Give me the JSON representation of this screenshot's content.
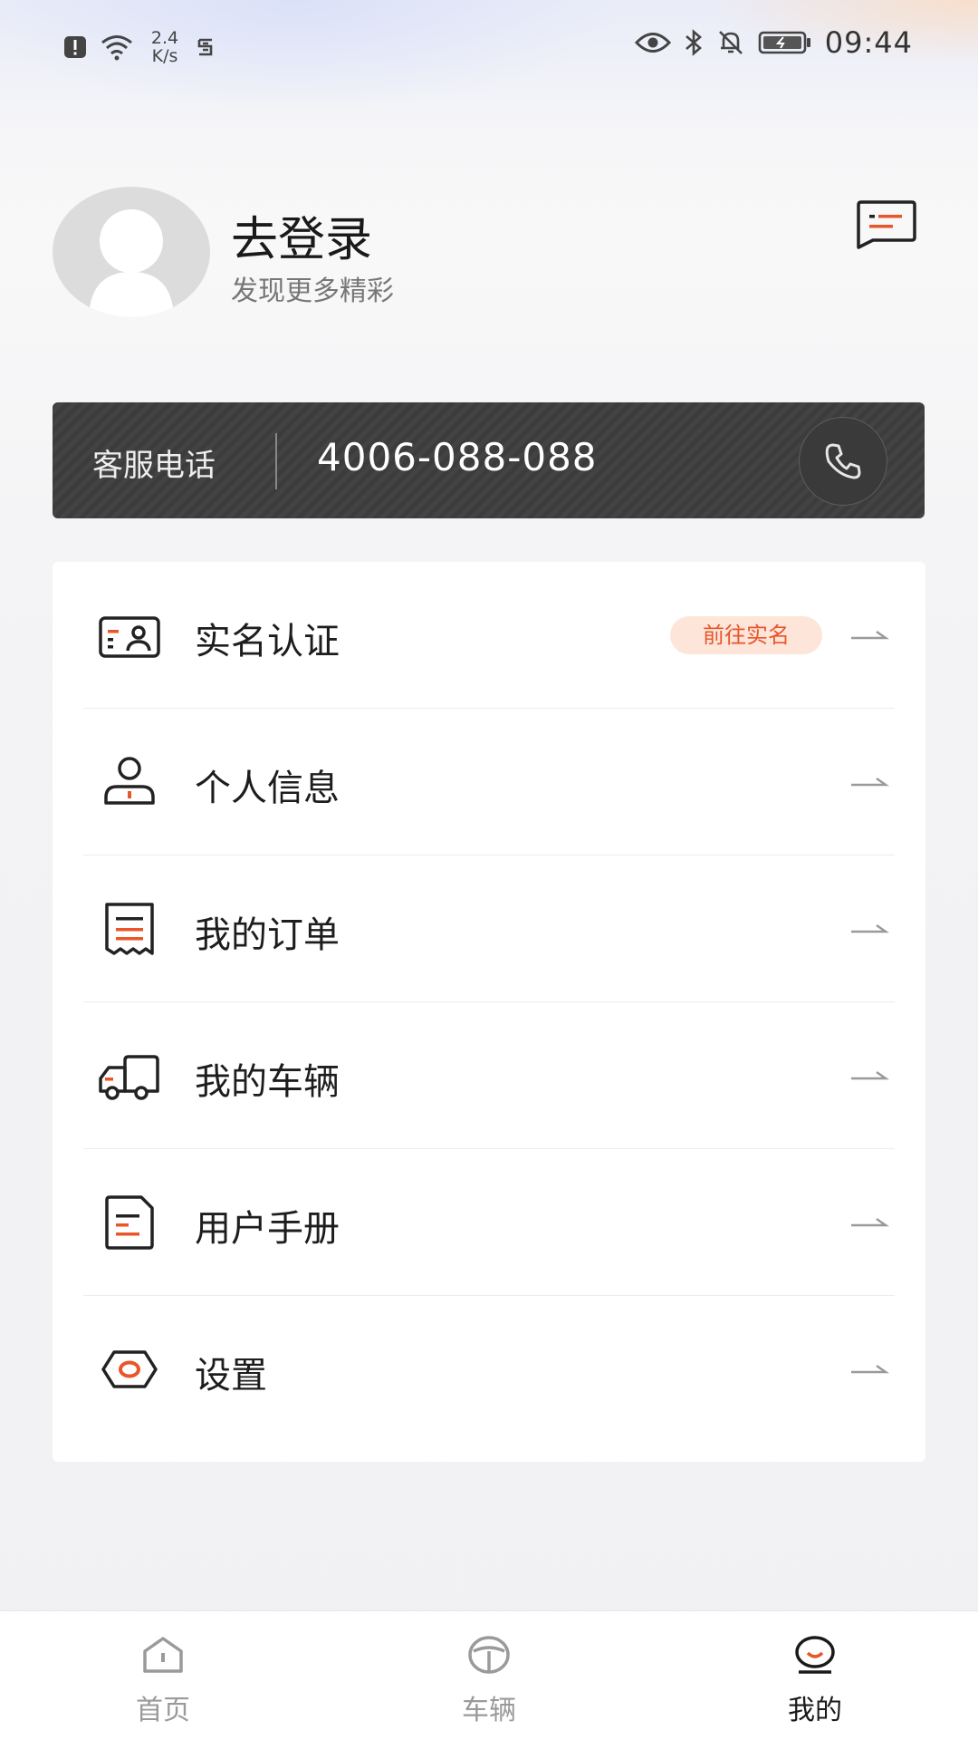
{
  "status_bar": {
    "speed_value": "2.4",
    "speed_unit": "K/s",
    "time": "09:44",
    "icons": [
      "alert-icon",
      "wifi-icon",
      "data-saver-icon",
      "eye-icon",
      "bluetooth-icon",
      "bell-off-icon",
      "battery-icon"
    ]
  },
  "header": {
    "login_title": "去登录",
    "login_subtitle": "发现更多精彩"
  },
  "hotline": {
    "label": "客服电话",
    "number": "4006-088-088"
  },
  "menu": {
    "items": [
      {
        "label": "实名认证",
        "icon": "id-card-icon",
        "badge": "前往实名"
      },
      {
        "label": "个人信息",
        "icon": "person-icon"
      },
      {
        "label": "我的订单",
        "icon": "receipt-icon"
      },
      {
        "label": "我的车辆",
        "icon": "vehicle-icon"
      },
      {
        "label": "用户手册",
        "icon": "manual-icon"
      },
      {
        "label": "设置",
        "icon": "settings-icon"
      }
    ]
  },
  "tabbar": {
    "tabs": [
      {
        "label": "首页",
        "icon": "home-icon",
        "active": false
      },
      {
        "label": "车辆",
        "icon": "steering-wheel-icon",
        "active": false
      },
      {
        "label": "我的",
        "icon": "profile-icon",
        "active": true
      }
    ]
  },
  "colors": {
    "accent": "#e8562a",
    "badge_bg": "#fde5da",
    "hotline_bg": "#3c3c3c",
    "tab_inactive": "#9a9a9a"
  }
}
